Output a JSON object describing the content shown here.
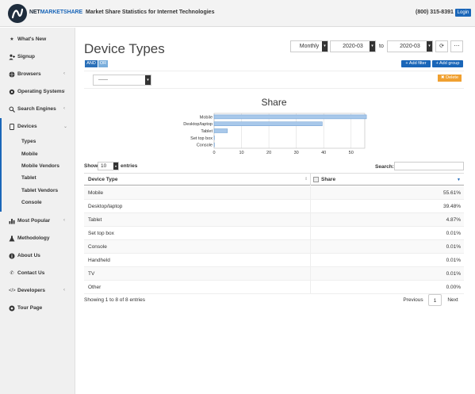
{
  "header": {
    "logo_text_left": "NET",
    "logo_text_right": "MARKETSHARE",
    "site_title": "Market Share Statistics for Internet Technologies",
    "phone": "(800) 315-8391",
    "login_label": "Login"
  },
  "sidebar": {
    "items": [
      {
        "label": "What's New",
        "icon": "star-icon"
      },
      {
        "label": "Signup",
        "icon": "user-plus-icon"
      },
      {
        "label": "Browsers",
        "icon": "globe-icon"
      },
      {
        "label": "Operating Systems",
        "icon": "gear-icon"
      },
      {
        "label": "Search Engines",
        "icon": "search-icon"
      },
      {
        "label": "Devices",
        "icon": "tablet-icon"
      },
      {
        "label": "Most Popular",
        "icon": "bar-chart-icon"
      },
      {
        "label": "Methodology",
        "icon": "flask-icon"
      },
      {
        "label": "About Us",
        "icon": "info-icon"
      },
      {
        "label": "Contact Us",
        "icon": "phone-icon"
      },
      {
        "label": "Developers",
        "icon": "code-icon"
      },
      {
        "label": "Tour Page",
        "icon": "help-icon"
      }
    ],
    "sub_items": [
      "Types",
      "Mobile",
      "Mobile Vendors",
      "Tablet",
      "Tablet Vendors",
      "Console"
    ]
  },
  "main": {
    "title": "Device Types",
    "period": "Monthly",
    "date_from": "2020-03",
    "to_label": "to",
    "date_to": "2020-03",
    "and_label": "AND",
    "or_label": "OR",
    "add_filter_label": "+ Add filter",
    "add_group_label": "+ Add group",
    "filter_select_value": "------",
    "delete_label": "✖ Delete"
  },
  "chart_data": {
    "type": "bar",
    "orientation": "horizontal",
    "title": "Share",
    "categories": [
      "Mobile",
      "Desktop/laptop",
      "Tablet",
      "Set top box",
      "Console"
    ],
    "values": [
      55.61,
      39.48,
      4.87,
      0.01,
      0.01
    ],
    "xlim": [
      0,
      55
    ],
    "xticks": [
      0,
      10,
      20,
      30,
      40,
      50
    ],
    "grid": true,
    "bar_color": "#a8c8ea",
    "bar_border": "#6a9cd0"
  },
  "table": {
    "show_label": "Show",
    "entries_value": "10",
    "entries_label": "entries",
    "search_label": "Search:",
    "headers": [
      "Device Type",
      "Share"
    ],
    "rows": [
      [
        "Mobile",
        "55.61%"
      ],
      [
        "Desktop/laptop",
        "39.48%"
      ],
      [
        "Tablet",
        "4.87%"
      ],
      [
        "Set top box",
        "0.01%"
      ],
      [
        "Console",
        "0.01%"
      ],
      [
        "Handheld",
        "0.01%"
      ],
      [
        "TV",
        "0.01%"
      ],
      [
        "Other",
        "0.00%"
      ]
    ],
    "info": "Showing 1 to 8 of 8 entries",
    "prev_label": "Previous",
    "page": "1",
    "next_label": "Next"
  }
}
